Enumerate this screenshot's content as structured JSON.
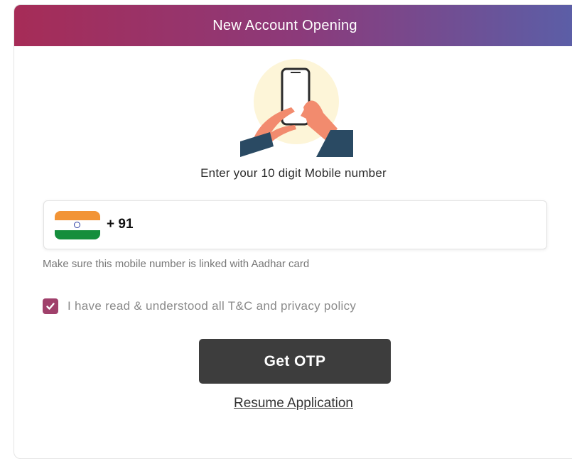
{
  "header": {
    "title": "New Account Opening"
  },
  "illustration": {
    "icon": "hands-holding-phone"
  },
  "mobile": {
    "prompt": "Enter your 10 digit Mobile number",
    "country_flag": "india-flag",
    "dial_code": "+ 91",
    "value": "",
    "hint": "Make sure this mobile number is linked with Aadhar card"
  },
  "terms": {
    "checked": true,
    "label": "I have read & understood all T&C and privacy policy"
  },
  "actions": {
    "get_otp_label": "Get OTP",
    "resume_label": "Resume Application"
  },
  "colors": {
    "header_gradient_start": "#a62c57",
    "header_gradient_end": "#5a5fa8",
    "checkbox": "#a0406b",
    "button": "#3d3d3d"
  }
}
